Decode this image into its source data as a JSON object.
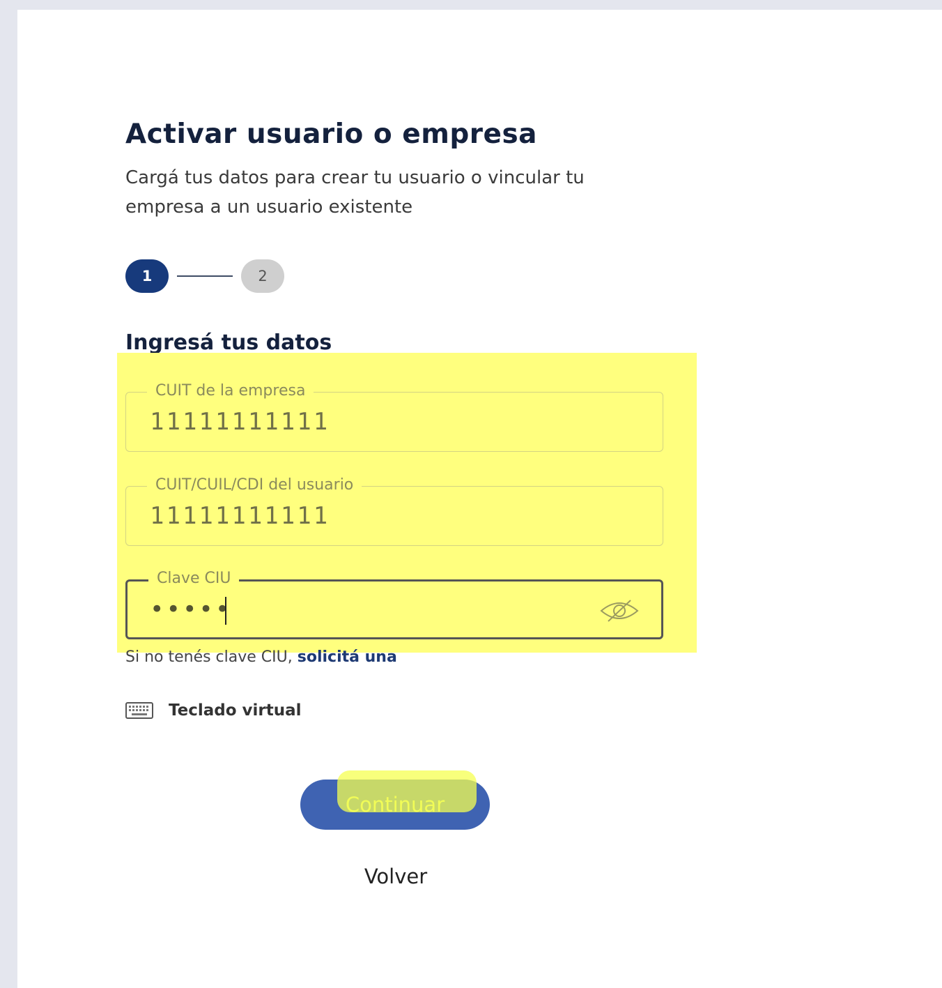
{
  "header": {
    "title": "Activar usuario o empresa",
    "subtitle": "Cargá tus datos para crear tu usuario o vincular tu empresa a un usuario existente"
  },
  "stepper": {
    "steps": [
      {
        "label": "1",
        "state": "active"
      },
      {
        "label": "2",
        "state": "inactive"
      }
    ]
  },
  "form": {
    "section_title": "Ingresá tus datos",
    "fields": [
      {
        "label": "CUIT de la empresa",
        "value": "11111111111"
      },
      {
        "label": "CUIT/CUIL/CDI del usuario",
        "value": "11111111111"
      },
      {
        "label": "Clave CIU",
        "value": "•••••",
        "icon": "eye-slash-icon"
      }
    ],
    "hint_text": "Si no tenés clave CIU, ",
    "hint_link": "solicitá una",
    "virtual_keyboard": {
      "label": "Teclado virtual",
      "icon": "keyboard-icon"
    }
  },
  "actions": {
    "continue_label": "Continuar",
    "back_label": "Volver"
  },
  "colors": {
    "primary": "#173a7c",
    "button": "#3f63b2",
    "highlight": "#ffff7e",
    "title_text": "#14213d"
  }
}
